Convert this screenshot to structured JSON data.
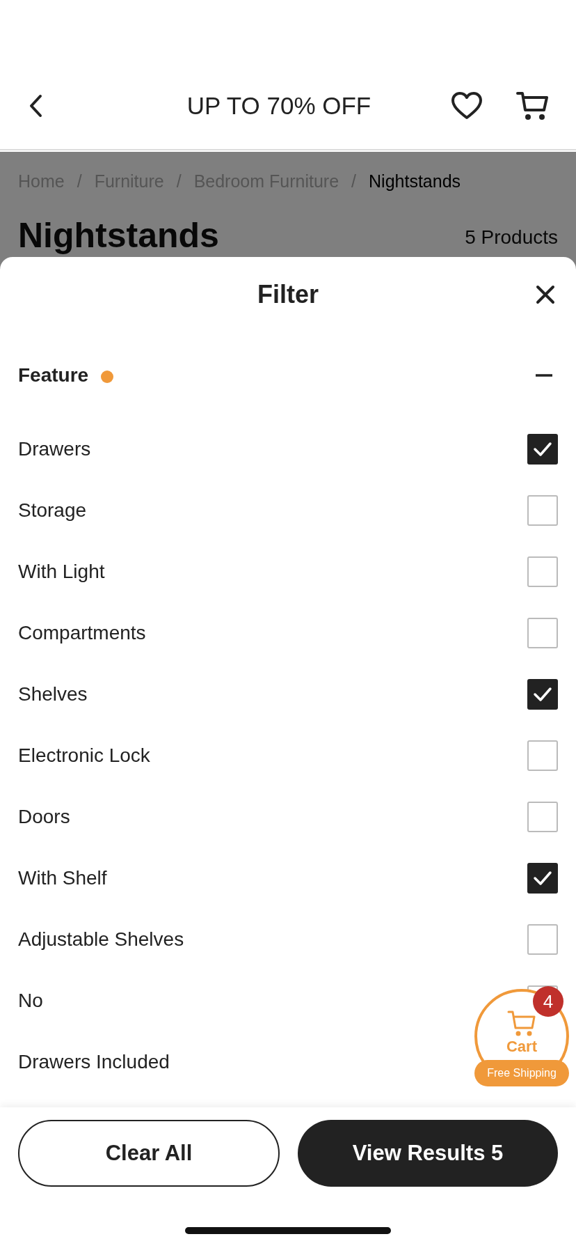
{
  "header": {
    "title": "UP TO 70% OFF"
  },
  "breadcrumb": [
    {
      "label": "Home",
      "separator": "/",
      "current": false
    },
    {
      "label": "Furniture",
      "separator": "/",
      "current": false
    },
    {
      "label": "Bedroom Furniture",
      "separator": "/",
      "current": false
    },
    {
      "label": "Nightstands",
      "current": true
    }
  ],
  "page": {
    "heading": "Nightstands",
    "count": "5 Products"
  },
  "filter": {
    "title": "Filter",
    "section": {
      "label": "Feature",
      "expanded": true,
      "active": true
    },
    "options": [
      {
        "label": "Drawers",
        "checked": true
      },
      {
        "label": "Storage",
        "checked": false
      },
      {
        "label": "With Light",
        "checked": false
      },
      {
        "label": "Compartments",
        "checked": false
      },
      {
        "label": "Shelves",
        "checked": true
      },
      {
        "label": "Electronic Lock",
        "checked": false
      },
      {
        "label": "Doors",
        "checked": false
      },
      {
        "label": "With Shelf",
        "checked": true
      },
      {
        "label": "Adjustable Shelves",
        "checked": false
      },
      {
        "label": "No",
        "checked": false
      },
      {
        "label": "Drawers Included"
      }
    ]
  },
  "footer": {
    "clear": "Clear All",
    "apply": "View Results 5"
  },
  "cart_widget": {
    "label": "Cart",
    "badge": "4",
    "tag": "Free Shipping"
  }
}
